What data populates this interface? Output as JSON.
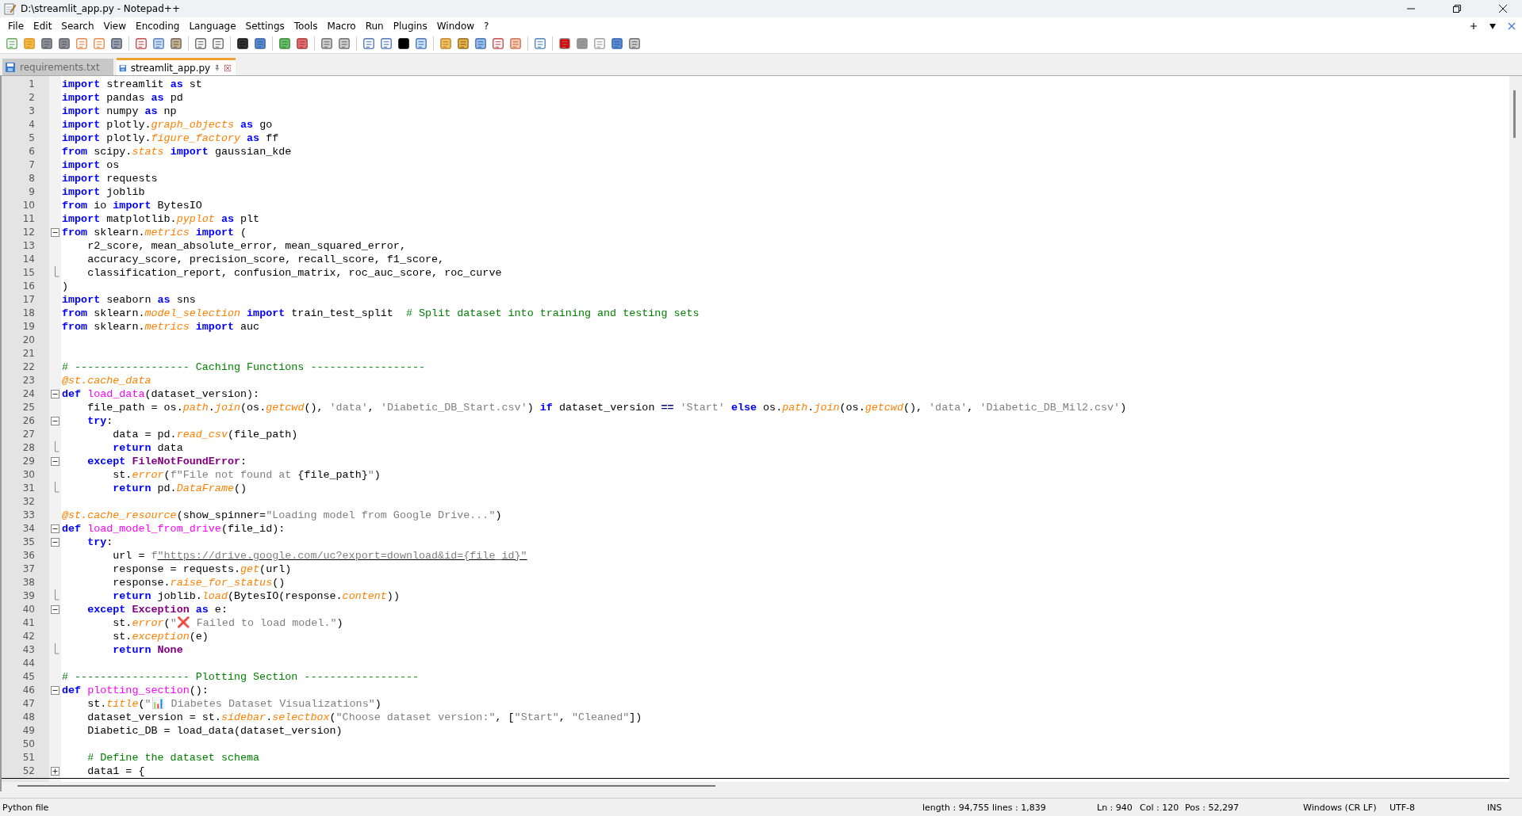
{
  "window": {
    "title": "D:\\streamlit_app.py - Notepad++"
  },
  "menu": [
    "File",
    "Edit",
    "Search",
    "View",
    "Encoding",
    "Language",
    "Settings",
    "Tools",
    "Macro",
    "Run",
    "Plugins",
    "Window",
    "?"
  ],
  "tabs": [
    {
      "label": "requirements.txt",
      "selected": false
    },
    {
      "label": "streamlit_app.py",
      "selected": true
    }
  ],
  "editor": {
    "lines": [
      {
        "number": "1",
        "tokens": [
          {
            "kind": "kw",
            "text": "import"
          },
          {
            "kind": "id",
            "text": " streamlit "
          },
          {
            "kind": "kw",
            "text": "as"
          },
          {
            "kind": "id",
            "text": " st"
          }
        ]
      },
      {
        "number": "2",
        "tokens": [
          {
            "kind": "kw",
            "text": "import"
          },
          {
            "kind": "id",
            "text": " pandas "
          },
          {
            "kind": "kw",
            "text": "as"
          },
          {
            "kind": "id",
            "text": " pd"
          }
        ]
      },
      {
        "number": "3",
        "tokens": [
          {
            "kind": "kw",
            "text": "import"
          },
          {
            "kind": "id",
            "text": " numpy "
          },
          {
            "kind": "kw",
            "text": "as"
          },
          {
            "kind": "id",
            "text": " np"
          }
        ]
      },
      {
        "number": "4",
        "tokens": [
          {
            "kind": "kw",
            "text": "import"
          },
          {
            "kind": "id",
            "text": " plotly."
          },
          {
            "kind": "attr",
            "text": "graph_objects"
          },
          {
            "kind": "kw",
            "text": " as"
          },
          {
            "kind": "id",
            "text": " go"
          }
        ]
      },
      {
        "number": "5",
        "tokens": [
          {
            "kind": "kw",
            "text": "import"
          },
          {
            "kind": "id",
            "text": " plotly."
          },
          {
            "kind": "attr",
            "text": "figure_factory"
          },
          {
            "kind": "kw",
            "text": " as"
          },
          {
            "kind": "id",
            "text": " ff"
          }
        ]
      },
      {
        "number": "6",
        "tokens": [
          {
            "kind": "kw",
            "text": "from"
          },
          {
            "kind": "id",
            "text": " scipy."
          },
          {
            "kind": "attr",
            "text": "stats"
          },
          {
            "kind": "kw",
            "text": " import"
          },
          {
            "kind": "id",
            "text": " gaussian_kde"
          }
        ]
      },
      {
        "number": "7",
        "tokens": [
          {
            "kind": "kw",
            "text": "import"
          },
          {
            "kind": "id",
            "text": " os"
          }
        ]
      },
      {
        "number": "8",
        "tokens": [
          {
            "kind": "kw",
            "text": "import"
          },
          {
            "kind": "id",
            "text": " requests"
          }
        ]
      },
      {
        "number": "9",
        "tokens": [
          {
            "kind": "kw",
            "text": "import"
          },
          {
            "kind": "id",
            "text": " joblib"
          }
        ]
      },
      {
        "number": "10",
        "tokens": [
          {
            "kind": "kw",
            "text": "from"
          },
          {
            "kind": "id",
            "text": " io "
          },
          {
            "kind": "kw",
            "text": "import"
          },
          {
            "kind": "id",
            "text": " BytesIO"
          }
        ]
      },
      {
        "number": "11",
        "tokens": [
          {
            "kind": "kw",
            "text": "import"
          },
          {
            "kind": "id",
            "text": " matplotlib."
          },
          {
            "kind": "attr",
            "text": "pyplot"
          },
          {
            "kind": "kw",
            "text": " as"
          },
          {
            "kind": "id",
            "text": " plt"
          }
        ]
      },
      {
        "number": "12",
        "fold_start": true,
        "folded": false,
        "tokens": [
          {
            "kind": "kw",
            "text": "from"
          },
          {
            "kind": "id",
            "text": " sklearn."
          },
          {
            "kind": "attr",
            "text": "metrics"
          },
          {
            "kind": "kw",
            "text": " import"
          },
          {
            "kind": "id",
            "text": " ("
          }
        ]
      },
      {
        "number": "13",
        "tokens": [
          {
            "kind": "id",
            "text": "    r2_score, mean_absolute_error, mean_squared_error,"
          }
        ]
      },
      {
        "number": "14",
        "tokens": [
          {
            "kind": "id",
            "text": "    accuracy_score, precision_score, recall_score, f1_score,"
          }
        ]
      },
      {
        "number": "15",
        "fold_end": true,
        "tokens": [
          {
            "kind": "id",
            "text": "    classification_report, confusion_matrix, roc_auc_score, roc_curve"
          }
        ]
      },
      {
        "number": "16",
        "tokens": [
          {
            "kind": "id",
            "text": ")"
          }
        ]
      },
      {
        "number": "17",
        "tokens": [
          {
            "kind": "kw",
            "text": "import"
          },
          {
            "kind": "id",
            "text": " seaborn "
          },
          {
            "kind": "kw",
            "text": "as"
          },
          {
            "kind": "id",
            "text": " sns"
          }
        ]
      },
      {
        "number": "18",
        "tokens": [
          {
            "kind": "kw",
            "text": "from"
          },
          {
            "kind": "id",
            "text": " sklearn."
          },
          {
            "kind": "attr",
            "text": "model_selection"
          },
          {
            "kind": "kw",
            "text": " import"
          },
          {
            "kind": "id",
            "text": " train_test_split  "
          },
          {
            "kind": "com",
            "text": "# Split dataset into training and testing sets"
          }
        ]
      },
      {
        "number": "19",
        "tokens": [
          {
            "kind": "kw",
            "text": "from"
          },
          {
            "kind": "id",
            "text": " sklearn."
          },
          {
            "kind": "attr",
            "text": "metrics"
          },
          {
            "kind": "kw",
            "text": " import"
          },
          {
            "kind": "id",
            "text": " auc"
          }
        ]
      },
      {
        "number": "20"
      },
      {
        "number": "21"
      },
      {
        "number": "22",
        "tokens": [
          {
            "kind": "com",
            "text": "# ------------------ Caching Functions ------------------"
          }
        ]
      },
      {
        "number": "23",
        "tokens": [
          {
            "kind": "deco",
            "text": "@st.cache_data"
          }
        ]
      },
      {
        "number": "24",
        "fold_start": true,
        "folded": false,
        "tokens": [
          {
            "kind": "kw",
            "text": "def"
          },
          {
            "kind": "def",
            "text": " load_data"
          },
          {
            "kind": "id",
            "text": "(dataset_version):"
          }
        ]
      },
      {
        "number": "25",
        "tokens": [
          {
            "kind": "id",
            "text": "    file_path = os."
          },
          {
            "kind": "attr",
            "text": "path"
          },
          {
            "kind": "id",
            "text": "."
          },
          {
            "kind": "attr",
            "text": "join"
          },
          {
            "kind": "id",
            "text": "(os."
          },
          {
            "kind": "attr",
            "text": "getcwd"
          },
          {
            "kind": "id",
            "text": "(), "
          },
          {
            "kind": "str",
            "text": "'data'"
          },
          {
            "kind": "id",
            "text": ", "
          },
          {
            "kind": "str",
            "text": "'Diabetic_DB_Start.csv'"
          },
          {
            "kind": "id",
            "text": ") "
          },
          {
            "kind": "kw",
            "text": "if"
          },
          {
            "kind": "id",
            "text": " dataset_version "
          },
          {
            "kind": "op",
            "text": "=="
          },
          {
            "kind": "str",
            "text": " 'Start'"
          },
          {
            "kind": "kw",
            "text": " else"
          },
          {
            "kind": "id",
            "text": " os."
          },
          {
            "kind": "attr",
            "text": "path"
          },
          {
            "kind": "id",
            "text": "."
          },
          {
            "kind": "attr",
            "text": "join"
          },
          {
            "kind": "id",
            "text": "(os."
          },
          {
            "kind": "attr",
            "text": "getcwd"
          },
          {
            "kind": "id",
            "text": "(), "
          },
          {
            "kind": "str",
            "text": "'data'"
          },
          {
            "kind": "id",
            "text": ", "
          },
          {
            "kind": "str",
            "text": "'Diabetic_DB_Mil2.csv'"
          },
          {
            "kind": "id",
            "text": ")"
          }
        ]
      },
      {
        "number": "26",
        "fold_start": true,
        "folded": false,
        "tokens": [
          {
            "kind": "kw",
            "text": "    try"
          },
          {
            "kind": "id",
            "text": ":"
          }
        ]
      },
      {
        "number": "27",
        "tokens": [
          {
            "kind": "id",
            "text": "        data = pd."
          },
          {
            "kind": "attr",
            "text": "read_csv"
          },
          {
            "kind": "id",
            "text": "(file_path)"
          }
        ]
      },
      {
        "number": "28",
        "fold_end": true,
        "tokens": [
          {
            "kind": "kw",
            "text": "        return"
          },
          {
            "kind": "id",
            "text": " data"
          }
        ]
      },
      {
        "number": "29",
        "fold_start": true,
        "folded": false,
        "tokens": [
          {
            "kind": "kw",
            "text": "    except"
          },
          {
            "kind": "cls",
            "text": " FileNotFoundError"
          },
          {
            "kind": "id",
            "text": ":"
          }
        ]
      },
      {
        "number": "30",
        "tokens": [
          {
            "kind": "id",
            "text": "        st."
          },
          {
            "kind": "attr",
            "text": "error"
          },
          {
            "kind": "id",
            "text": "("
          },
          {
            "kind": "str",
            "text": "f\"File not found at "
          },
          {
            "kind": "id",
            "text": "{file_path}"
          },
          {
            "kind": "str",
            "text": "\""
          },
          {
            "kind": "id",
            "text": ")"
          }
        ]
      },
      {
        "number": "31",
        "fold_end": true,
        "tokens": [
          {
            "kind": "kw",
            "text": "        return"
          },
          {
            "kind": "id",
            "text": " pd."
          },
          {
            "kind": "attr",
            "text": "DataFrame"
          },
          {
            "kind": "id",
            "text": "()"
          }
        ]
      },
      {
        "number": "32"
      },
      {
        "number": "33",
        "tokens": [
          {
            "kind": "deco",
            "text": "@st.cache_resource"
          },
          {
            "kind": "id",
            "text": "(show_spinner="
          },
          {
            "kind": "str",
            "text": "\"Loading model from Google Drive...\""
          },
          {
            "kind": "id",
            "text": ")"
          }
        ]
      },
      {
        "number": "34",
        "fold_start": true,
        "folded": false,
        "tokens": [
          {
            "kind": "kw",
            "text": "def"
          },
          {
            "kind": "def",
            "text": " load_model_from_drive"
          },
          {
            "kind": "id",
            "text": "(file_id):"
          }
        ]
      },
      {
        "number": "35",
        "fold_start": true,
        "folded": false,
        "tokens": [
          {
            "kind": "kw",
            "text": "    try"
          },
          {
            "kind": "id",
            "text": ":"
          }
        ]
      },
      {
        "number": "36",
        "tokens": [
          {
            "kind": "id",
            "text": "        url = "
          },
          {
            "kind": "str",
            "text": "f"
          },
          {
            "kind": "url",
            "text": "\"https://drive.google.com/uc?export=download&id={file_id}\""
          }
        ]
      },
      {
        "number": "37",
        "tokens": [
          {
            "kind": "id",
            "text": "        response = requests."
          },
          {
            "kind": "attr",
            "text": "get"
          },
          {
            "kind": "id",
            "text": "(url)"
          }
        ]
      },
      {
        "number": "38",
        "tokens": [
          {
            "kind": "id",
            "text": "        response."
          },
          {
            "kind": "attr",
            "text": "raise_for_status"
          },
          {
            "kind": "id",
            "text": "()"
          }
        ]
      },
      {
        "number": "39",
        "fold_end": true,
        "tokens": [
          {
            "kind": "kw",
            "text": "        return"
          },
          {
            "kind": "id",
            "text": " joblib."
          },
          {
            "kind": "attr",
            "text": "load"
          },
          {
            "kind": "id",
            "text": "(BytesIO(response."
          },
          {
            "kind": "attr",
            "text": "content"
          },
          {
            "kind": "id",
            "text": "))"
          }
        ]
      },
      {
        "number": "40",
        "fold_start": true,
        "folded": false,
        "tokens": [
          {
            "kind": "kw",
            "text": "    except"
          },
          {
            "kind": "cls",
            "text": " Exception"
          },
          {
            "kind": "kw",
            "text": " as"
          },
          {
            "kind": "id",
            "text": " e:"
          }
        ]
      },
      {
        "number": "41",
        "tokens": [
          {
            "kind": "id",
            "text": "        st."
          },
          {
            "kind": "attr",
            "text": "error"
          },
          {
            "kind": "id",
            "text": "("
          },
          {
            "kind": "str",
            "text": "\"❌ Failed to load model.\""
          },
          {
            "kind": "id",
            "text": ")"
          }
        ]
      },
      {
        "number": "42",
        "tokens": [
          {
            "kind": "id",
            "text": "        st."
          },
          {
            "kind": "attr",
            "text": "exception"
          },
          {
            "kind": "id",
            "text": "(e)"
          }
        ]
      },
      {
        "number": "43",
        "fold_end": true,
        "tokens": [
          {
            "kind": "kw",
            "text": "        return"
          },
          {
            "kind": "cls",
            "text": " None"
          }
        ]
      },
      {
        "number": "44"
      },
      {
        "number": "45",
        "tokens": [
          {
            "kind": "com",
            "text": "# ------------------ Plotting Section ------------------"
          }
        ]
      },
      {
        "number": "46",
        "fold_start": true,
        "folded": false,
        "tokens": [
          {
            "kind": "kw",
            "text": "def"
          },
          {
            "kind": "def",
            "text": " plotting_section"
          },
          {
            "kind": "id",
            "text": "():"
          }
        ]
      },
      {
        "number": "47",
        "tokens": [
          {
            "kind": "id",
            "text": "    st."
          },
          {
            "kind": "attr",
            "text": "title"
          },
          {
            "kind": "id",
            "text": "("
          },
          {
            "kind": "str",
            "text": "\"📊 Diabetes Dataset Visualizations\""
          },
          {
            "kind": "id",
            "text": ")"
          }
        ]
      },
      {
        "number": "48",
        "tokens": [
          {
            "kind": "id",
            "text": "    dataset_version = st."
          },
          {
            "kind": "attr",
            "text": "sidebar"
          },
          {
            "kind": "id",
            "text": "."
          },
          {
            "kind": "attr",
            "text": "selectbox"
          },
          {
            "kind": "id",
            "text": "("
          },
          {
            "kind": "str",
            "text": "\"Choose dataset version:\""
          },
          {
            "kind": "id",
            "text": ", ["
          },
          {
            "kind": "str",
            "text": "\"Start\""
          },
          {
            "kind": "id",
            "text": ", "
          },
          {
            "kind": "str",
            "text": "\"Cleaned\""
          },
          {
            "kind": "id",
            "text": "])"
          }
        ]
      },
      {
        "number": "49",
        "tokens": [
          {
            "kind": "id",
            "text": "    Diabetic_DB = load_data(dataset_version)"
          }
        ]
      },
      {
        "number": "50"
      },
      {
        "number": "51",
        "tokens": [
          {
            "kind": "com",
            "text": "    # Define the dataset schema"
          }
        ]
      },
      {
        "number": "52",
        "fold_start": true,
        "folded": true,
        "tokens": [
          {
            "kind": "id",
            "text": "    data1 = {"
          }
        ]
      }
    ]
  },
  "status_bar": {
    "file_type": "Python file",
    "length": "length : 94,755",
    "lines": "lines : 1,839",
    "ln": "Ln : 940",
    "col": "Col : 120",
    "pos": "Pos : 52,297",
    "eol": "Windows (CR LF)",
    "encoding": "UTF-8",
    "mode": "INS"
  }
}
